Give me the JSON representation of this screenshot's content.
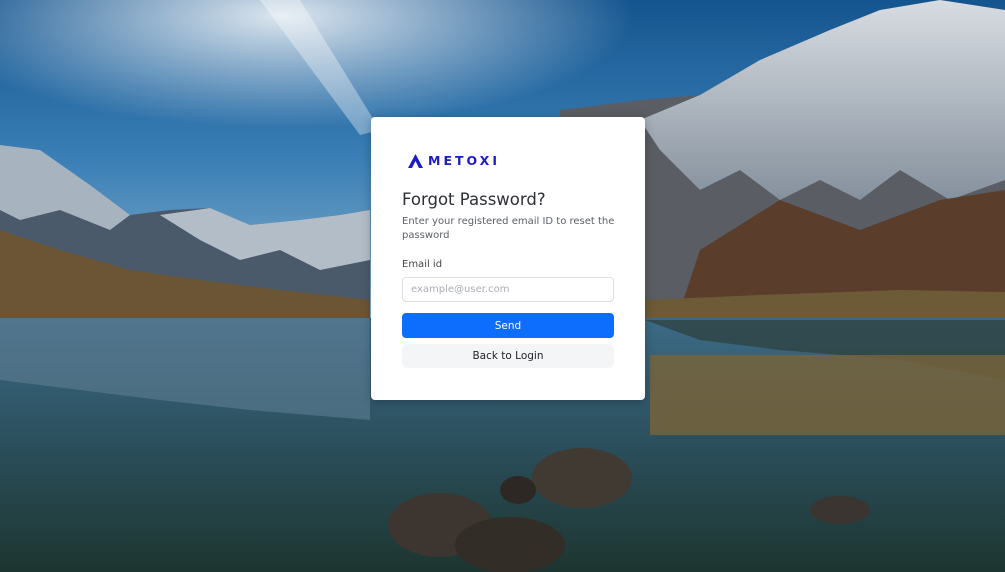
{
  "brand": {
    "name": "METOXI",
    "color": "#1d1bc4"
  },
  "form": {
    "title": "Forgot Password?",
    "subtitle": "Enter your registered email ID to reset the password",
    "email_label": "Email id",
    "email_placeholder": "example@user.com",
    "email_value": "",
    "send_label": "Send",
    "back_label": "Back to Login"
  },
  "colors": {
    "primary": "#0d6efd",
    "secondary_button_bg": "#f4f5f7"
  },
  "background": {
    "description_icon": "mountain-lake-landscape"
  }
}
